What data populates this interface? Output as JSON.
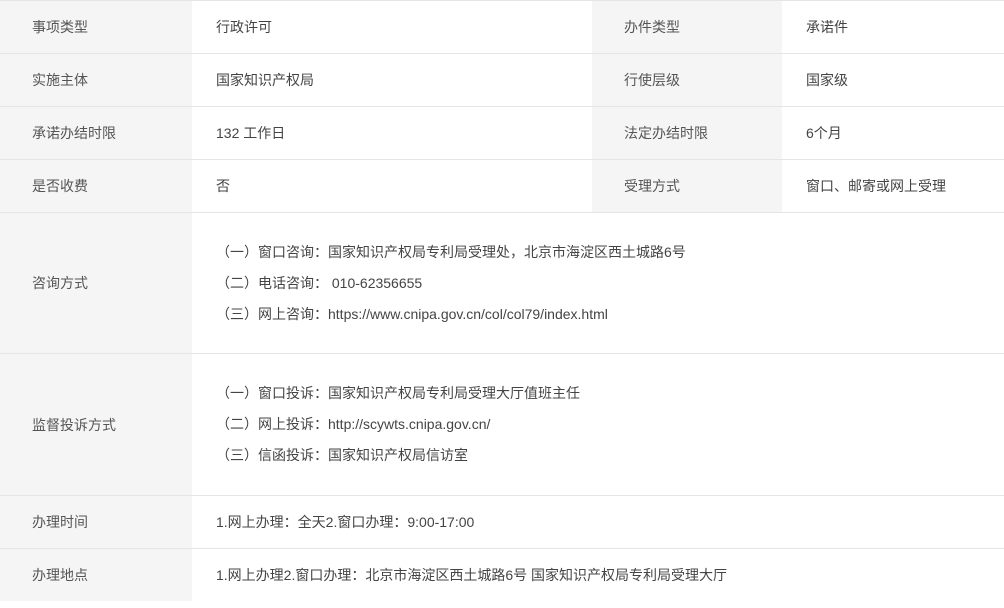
{
  "rows": {
    "r1": {
      "label1": "事项类型",
      "value1": "行政许可",
      "label2": "办件类型",
      "value2": "承诺件"
    },
    "r2": {
      "label1": "实施主体",
      "value1": "国家知识产权局",
      "label2": "行使层级",
      "value2": "国家级"
    },
    "r3": {
      "label1": "承诺办结时限",
      "value1": "132 工作日",
      "label2": "法定办结时限",
      "value2": "6个月"
    },
    "r4": {
      "label1": "是否收费",
      "value1": "否",
      "label2": "受理方式",
      "value2": "窗口、邮寄或网上受理"
    },
    "r5": {
      "label": "咨询方式",
      "lines": {
        "l1": "（一）窗口咨询：国家知识产权局专利局受理处，北京市海淀区西土城路6号",
        "l2": "（二）电话咨询： 010-62356655",
        "l3": "（三）网上咨询：https://www.cnipa.gov.cn/col/col79/index.html"
      }
    },
    "r6": {
      "label": "监督投诉方式",
      "lines": {
        "l1": "（一）窗口投诉：国家知识产权局专利局受理大厅值班主任",
        "l2": "（二）网上投诉：http://scywts.cnipa.gov.cn/",
        "l3": "（三）信函投诉：国家知识产权局信访室"
      }
    },
    "r7": {
      "label": "办理时间",
      "value": "1.网上办理：全天2.窗口办理：9:00-17:00"
    },
    "r8": {
      "label": "办理地点",
      "value": "1.网上办理2.窗口办理：北京市海淀区西土城路6号 国家知识产权局专利局受理大厅"
    }
  }
}
